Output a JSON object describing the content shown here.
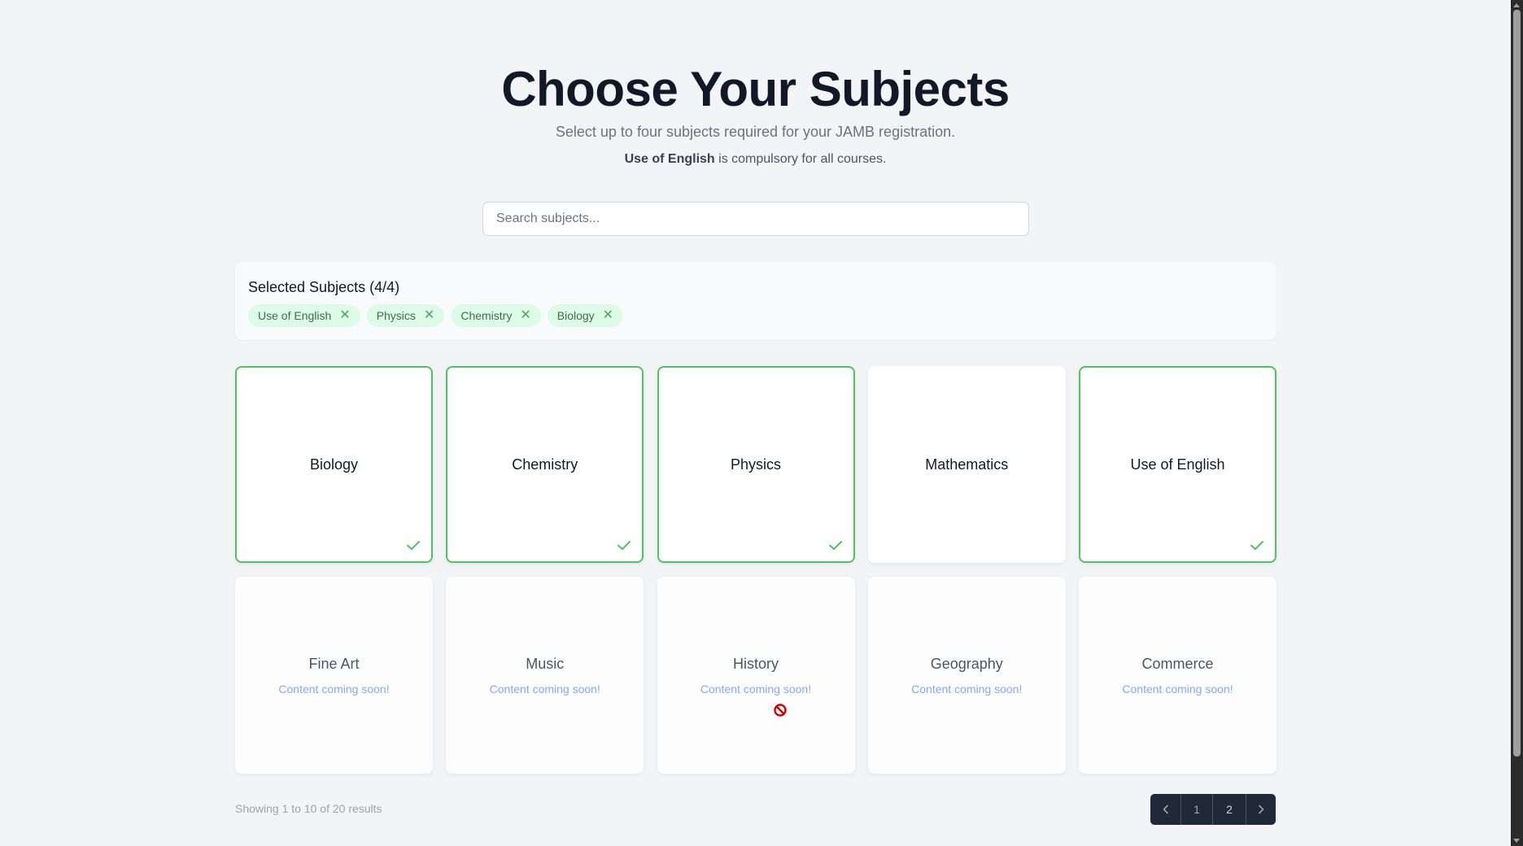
{
  "header": {
    "title": "Choose Your Subjects",
    "subtitle": "Select up to four subjects required for your JAMB registration.",
    "note_bold": "Use of English",
    "note_rest": " is compulsory for all courses."
  },
  "search": {
    "placeholder": "Search subjects...",
    "value": ""
  },
  "selected": {
    "title": "Selected Subjects (4/4)",
    "count": 4,
    "max": 4,
    "chips": [
      {
        "label": "Use of English",
        "remove_icon": "close-icon"
      },
      {
        "label": "Physics",
        "remove_icon": "close-icon"
      },
      {
        "label": "Chemistry",
        "remove_icon": "close-icon"
      },
      {
        "label": "Biology",
        "remove_icon": "close-icon"
      }
    ]
  },
  "subjects": [
    {
      "name": "Biology",
      "selected": true,
      "available": true
    },
    {
      "name": "Chemistry",
      "selected": true,
      "available": true
    },
    {
      "name": "Physics",
      "selected": true,
      "available": true
    },
    {
      "name": "Mathematics",
      "selected": false,
      "available": true
    },
    {
      "name": "Use of English",
      "selected": true,
      "available": true
    },
    {
      "name": "Fine Art",
      "selected": false,
      "available": false,
      "status": "Content coming soon!"
    },
    {
      "name": "Music",
      "selected": false,
      "available": false,
      "status": "Content coming soon!"
    },
    {
      "name": "History",
      "selected": false,
      "available": false,
      "status": "Content coming soon!"
    },
    {
      "name": "Geography",
      "selected": false,
      "available": false,
      "status": "Content coming soon!"
    },
    {
      "name": "Commerce",
      "selected": false,
      "available": false,
      "status": "Content coming soon!"
    }
  ],
  "footer": {
    "results_text": "Showing 1 to 10 of 20 results",
    "pagination": {
      "prev_icon": "chevron-left-icon",
      "pages": [
        "1",
        "2"
      ],
      "current_page": "2",
      "next_icon": "chevron-right-icon"
    }
  },
  "colors": {
    "accent_green": "#50c25f",
    "chip_bg": "#dcfce7",
    "coming_soon_blue": "#86a8f2",
    "pager_bg": "#1f2937",
    "page_bg": "#f3f4f6"
  },
  "cursor": {
    "icon": "not-allowed-cursor-icon"
  }
}
